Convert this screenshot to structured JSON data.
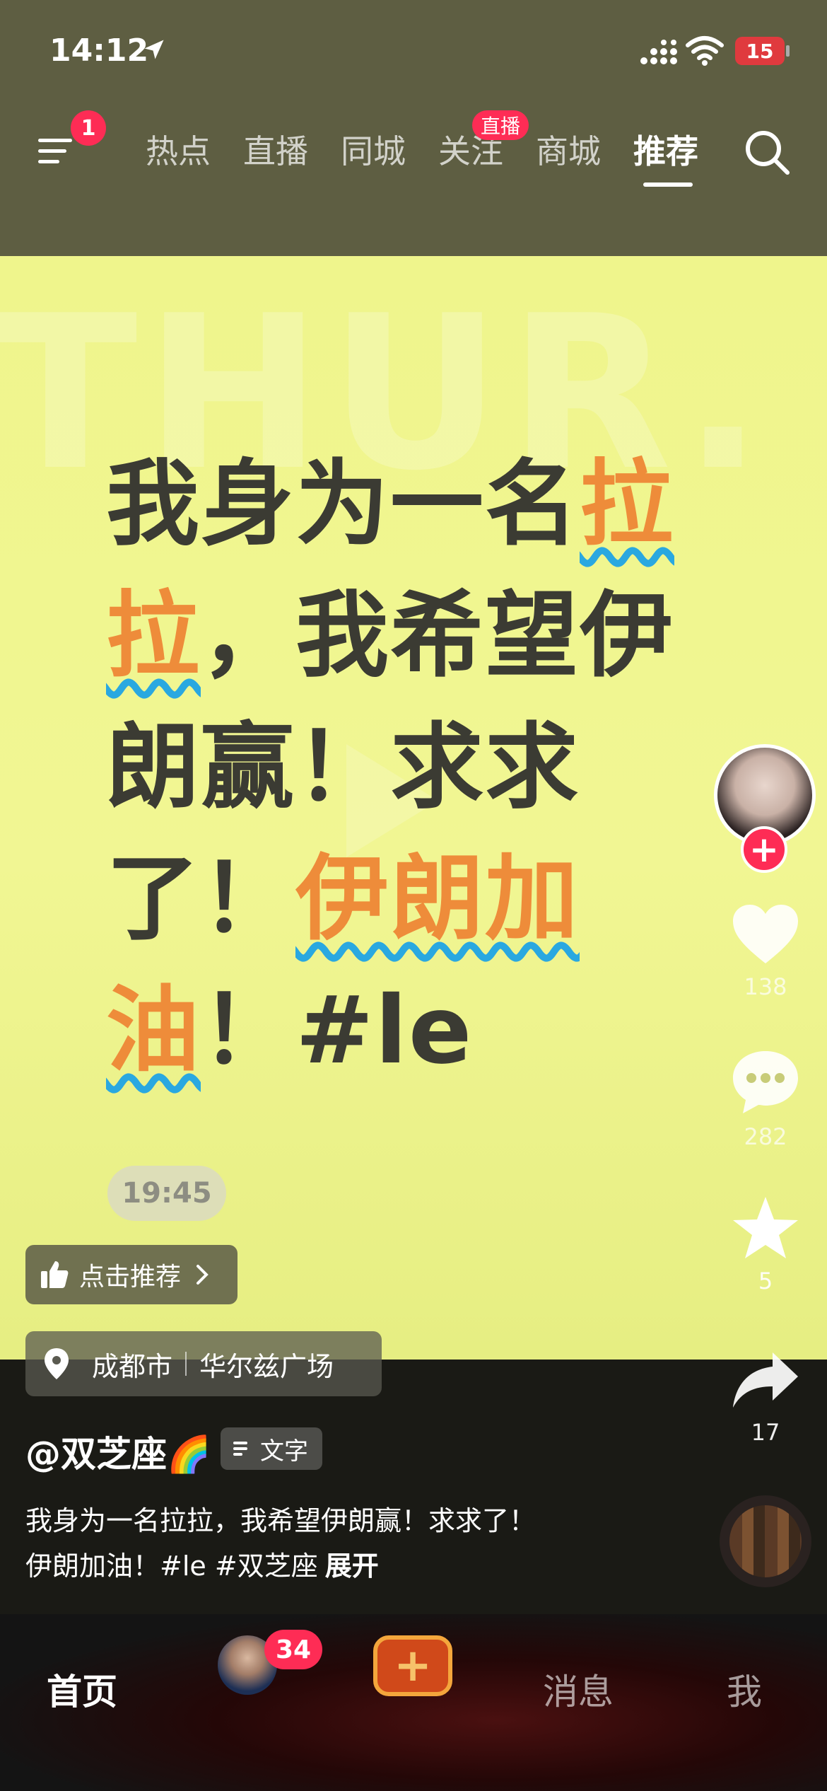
{
  "status_bar": {
    "time": "14:12",
    "battery": "15"
  },
  "top_nav": {
    "menu_badge": "1",
    "tabs": [
      {
        "label": "热点",
        "active": false
      },
      {
        "label": "直播",
        "active": false
      },
      {
        "label": "同城",
        "active": false
      },
      {
        "label": "关注",
        "active": false,
        "badge": "直播"
      },
      {
        "label": "商城",
        "active": false
      },
      {
        "label": "推荐",
        "active": true
      }
    ]
  },
  "video": {
    "background_text": "THUR.",
    "lyrics_line1": "我身为一名",
    "lyrics_hl1": "拉",
    "lyrics_hl2": "拉",
    "lyrics_line2": "，我希望伊",
    "lyrics_line3": "朗赢！求求",
    "lyrics_line4a": "了！",
    "lyrics_hl3": "伊朗加",
    "lyrics_hl4": "油",
    "lyrics_line5": "！#le",
    "timestamp": "19:45"
  },
  "side_bar": {
    "like_count": "138",
    "comment_count": "282",
    "favorite_count": "5",
    "share_count": "17"
  },
  "info": {
    "recommend_label": "点击推荐",
    "location_city": "成都市",
    "location_place": "华尔兹广场",
    "author": "@双芝座🌈",
    "text_tag": "文字",
    "caption_line1": "我身为一名拉拉，我希望伊朗赢！求求了！",
    "caption_line2": "伊朗加油！#le #双芝座",
    "expand_label": "展开"
  },
  "tab_bar": {
    "home": "首页",
    "friends_badge": "34",
    "messages": "消息",
    "me": "我"
  },
  "colors": {
    "accent": "#fe2c55",
    "highlight": "#ee8c3a",
    "video_bg": "#eff58c"
  }
}
